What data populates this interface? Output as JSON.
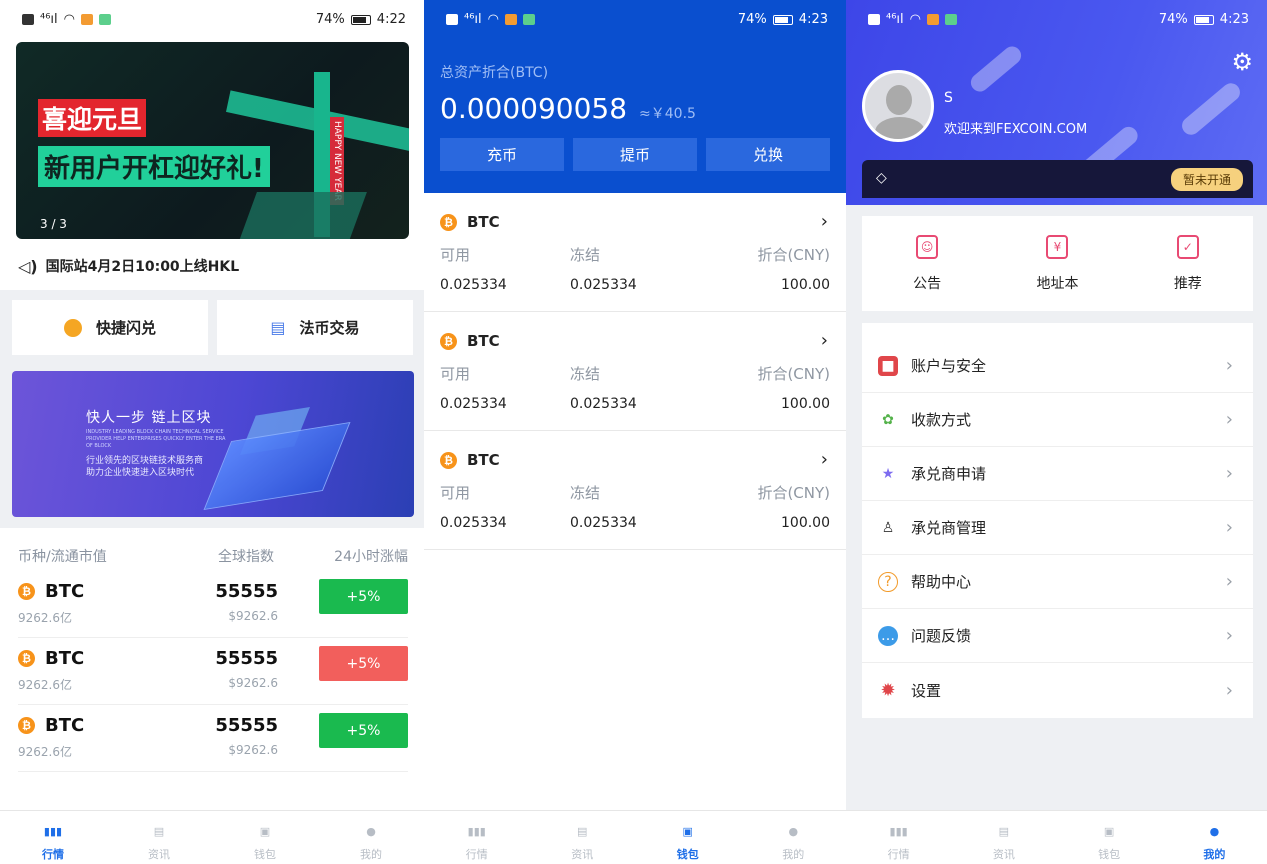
{
  "colors": {
    "primary": "#0a4fcf",
    "tab_active": "#1f6fe8",
    "up_green": "#1aba4f",
    "down_red": "#f25f5c",
    "profile_purple": "#4450ec"
  },
  "panel_market": {
    "status": {
      "battery": "74%",
      "time": "4:22"
    },
    "banner": {
      "title1": "喜迎元旦",
      "title2": "新用户开杠迎好礼!",
      "sign": "HAPPY NEW YEAR",
      "pager": "3 / 3"
    },
    "notice": "国际站4月2日10:00上线HKL",
    "quick": [
      {
        "label": "快捷闪兑",
        "icon": "coin-icon"
      },
      {
        "label": "法币交易",
        "icon": "fiat-trade-icon"
      }
    ],
    "promo": {
      "headline": "快人一步   链上区块",
      "english": "INDUSTRY LEADING BLOCK CHAIN TECHNICAL SERVICE PROVIDER HELP ENTERPRISES QUICKLY ENTER THE ERA OF BLOCK",
      "line1": "行业领先的区块链技术服务商",
      "line2": "助力企业快速进入区块时代"
    },
    "table_headers": [
      "币种/流通市值",
      "全球指数",
      "24小时涨幅"
    ],
    "rows": [
      {
        "symbol": "BTC",
        "cap": "9262.6亿",
        "index": "55555",
        "usd": "$9262.6",
        "change": "+5%",
        "trend": "up"
      },
      {
        "symbol": "BTC",
        "cap": "9262.6亿",
        "index": "55555",
        "usd": "$9262.6",
        "change": "+5%",
        "trend": "down"
      },
      {
        "symbol": "BTC",
        "cap": "9262.6亿",
        "index": "55555",
        "usd": "$9262.6",
        "change": "+5%",
        "trend": "up"
      }
    ]
  },
  "panel_wallet": {
    "status": {
      "battery": "74%",
      "time": "4:23"
    },
    "total_label": "总资产折合(BTC)",
    "total_value": "0.000090058",
    "total_cny": "≈￥40.5",
    "actions": [
      "充币",
      "提币",
      "兑换"
    ],
    "col_labels": [
      "可用",
      "冻结",
      "折合(CNY)"
    ],
    "assets": [
      {
        "symbol": "BTC",
        "available": "0.025334",
        "frozen": "0.025334",
        "cny": "100.00"
      },
      {
        "symbol": "BTC",
        "available": "0.025334",
        "frozen": "0.025334",
        "cny": "100.00"
      },
      {
        "symbol": "BTC",
        "available": "0.025334",
        "frozen": "0.025334",
        "cny": "100.00"
      }
    ]
  },
  "panel_profile": {
    "status": {
      "battery": "74%",
      "time": "4:23"
    },
    "username": "S",
    "welcome": "欢迎来到FEXCOIN.COM",
    "vip_button": "暂未开通",
    "grid": [
      {
        "label": "公告",
        "icon": "announcement-icon",
        "glyph": "☺"
      },
      {
        "label": "地址本",
        "icon": "address-book-icon",
        "glyph": "¥"
      },
      {
        "label": "推荐",
        "icon": "recommend-icon",
        "glyph": "✓"
      }
    ],
    "menu": [
      {
        "label": "账户与安全",
        "icon": "account-security-icon",
        "glyph": "■",
        "color": "#e0464a"
      },
      {
        "label": "收款方式",
        "icon": "payment-method-icon",
        "glyph": "✿",
        "color": "#54b24a"
      },
      {
        "label": "承兑商申请",
        "icon": "star-icon",
        "glyph": "★",
        "color": "#7d6cf0"
      },
      {
        "label": "承兑商管理",
        "icon": "users-icon",
        "glyph": "♙",
        "color": "#333333"
      },
      {
        "label": "帮助中心",
        "icon": "help-icon",
        "glyph": "?",
        "color": "#f29b2b"
      },
      {
        "label": "问题反馈",
        "icon": "feedback-icon",
        "glyph": "…",
        "color": "#3c9be8"
      },
      {
        "label": "设置",
        "icon": "settings-icon",
        "glyph": "✹",
        "color": "#e0464a"
      }
    ]
  },
  "tabbar": [
    "行情",
    "资讯",
    "钱包",
    "我的"
  ]
}
